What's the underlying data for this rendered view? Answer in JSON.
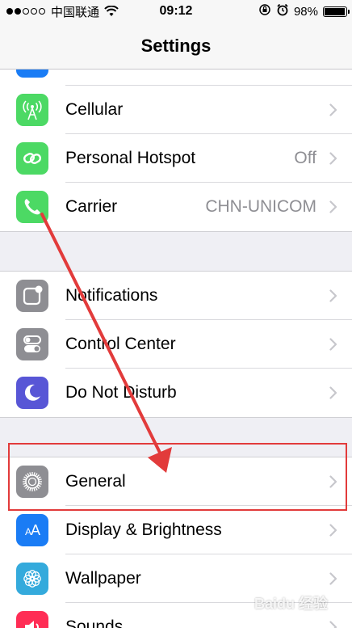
{
  "status_bar": {
    "carrier": "中国联通",
    "time": "09:12",
    "battery_percent": "98%",
    "battery_level": 0.98,
    "signal_bars_filled": 2,
    "signal_bars_total": 5
  },
  "nav": {
    "title": "Settings"
  },
  "groups": [
    [
      {
        "label": "",
        "value": "",
        "icon": "partial-blue-icon",
        "color": "#1a7cf5",
        "partial": true
      },
      {
        "label": "Cellular",
        "value": "",
        "icon": "cellular-antenna-icon",
        "color": "#4cd964"
      },
      {
        "label": "Personal Hotspot",
        "value": "Off",
        "icon": "hotspot-link-icon",
        "color": "#4cd964"
      },
      {
        "label": "Carrier",
        "value": "CHN-UNICOM",
        "icon": "phone-icon",
        "color": "#4cd964"
      }
    ],
    [
      {
        "label": "Notifications",
        "value": "",
        "icon": "notifications-icon",
        "color": "#8e8e93"
      },
      {
        "label": "Control Center",
        "value": "",
        "icon": "control-center-icon",
        "color": "#8e8e93"
      },
      {
        "label": "Do Not Disturb",
        "value": "",
        "icon": "moon-icon",
        "color": "#5856d6"
      }
    ],
    [
      {
        "label": "General",
        "value": "",
        "icon": "gear-icon",
        "color": "#8e8e93"
      },
      {
        "label": "Display & Brightness",
        "value": "",
        "icon": "display-aa-icon",
        "color": "#1a7cf5"
      },
      {
        "label": "Wallpaper",
        "value": "",
        "icon": "wallpaper-flower-icon",
        "color": "#34aadc"
      },
      {
        "label": "Sounds",
        "value": "",
        "icon": "speaker-icon",
        "color": "#ff2d55"
      }
    ]
  ],
  "annotation": {
    "arrow_color": "#e23b3b",
    "highlight_color": "#e23b3b"
  },
  "watermark": "Baidu 经验"
}
